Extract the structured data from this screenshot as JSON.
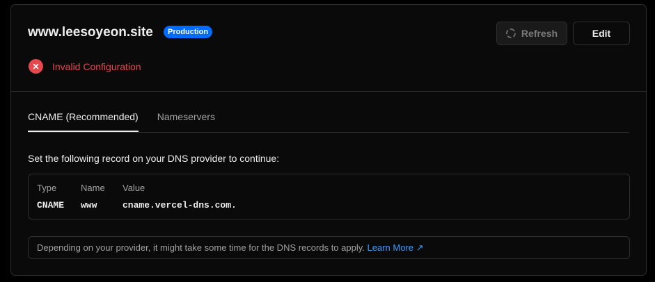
{
  "domain": {
    "name": "www.leesoyeon.site",
    "environment_badge": "Production"
  },
  "status": {
    "icon": "x-circle-icon",
    "text": "Invalid Configuration",
    "color": "#e5484d"
  },
  "actions": {
    "refresh_label": "Refresh",
    "edit_label": "Edit"
  },
  "tabs": [
    {
      "label": "CNAME (Recommended)",
      "active": true
    },
    {
      "label": "Nameservers",
      "active": false
    }
  ],
  "instruction": "Set the following record on your DNS provider to continue:",
  "record": {
    "headers": [
      "Type",
      "Name",
      "Value"
    ],
    "values": [
      "CNAME",
      "www",
      "cname.vercel-dns.com."
    ]
  },
  "note": {
    "text": "Depending on your provider, it might take some time for the DNS records to apply.",
    "link_label": "Learn More",
    "link_color": "#3b9eff"
  }
}
